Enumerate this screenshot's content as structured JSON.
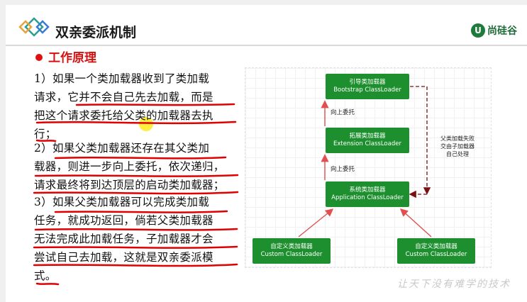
{
  "header": {
    "title": "双亲委派机制",
    "brand": "尚硅谷",
    "brand_icon_letter": "U"
  },
  "section": {
    "heading": "工作原理"
  },
  "paragraphs": [
    [
      "1）如果一个类加载器收到了类加载",
      "请求，它并不会自己先去加载，而是",
      "把这个请求委托给父类的加载器去执",
      "行；"
    ],
    [
      "2）如果父类加载器还存在其父类加",
      "载器，则进一步向上委托，依次递归，",
      "请求最终将到达顶层的启动类加载器；"
    ],
    [
      "3）如果父类加载器可以完成类加载",
      "任务，就成功返回，倘若父类加载器",
      "无法完成此加载任务，子加载器才会",
      "尝试自己去加载，这就是双亲委派模",
      "式。"
    ]
  ],
  "diagram": {
    "bootstrap": {
      "cn": "引导类加载器",
      "en": "Bootstrap ClassLoader"
    },
    "extension": {
      "cn": "拓展类加载器",
      "en": "Extension ClassLoader"
    },
    "application": {
      "cn": "系统类加载器",
      "en": "Application ClassLoader"
    },
    "custom_left": {
      "cn": "自定义类加载器",
      "en": "Custom ClassLoader"
    },
    "custom_right": {
      "cn": "自定义类加载器",
      "en": "Custom ClassLoader"
    },
    "up_label_1": "向上委托",
    "up_label_2": "向上委托",
    "side_note": [
      "父类加载失败",
      "交由子加载器",
      "自己处理"
    ],
    "colors": {
      "box": "#1e8f2e",
      "arrow": "#e05050",
      "dashed_arrow": "#7a1010"
    }
  },
  "watermark": "让天下没有难学的技术",
  "colors": {
    "accent_red": "#d41111",
    "brand_green": "#1f7a3c"
  }
}
